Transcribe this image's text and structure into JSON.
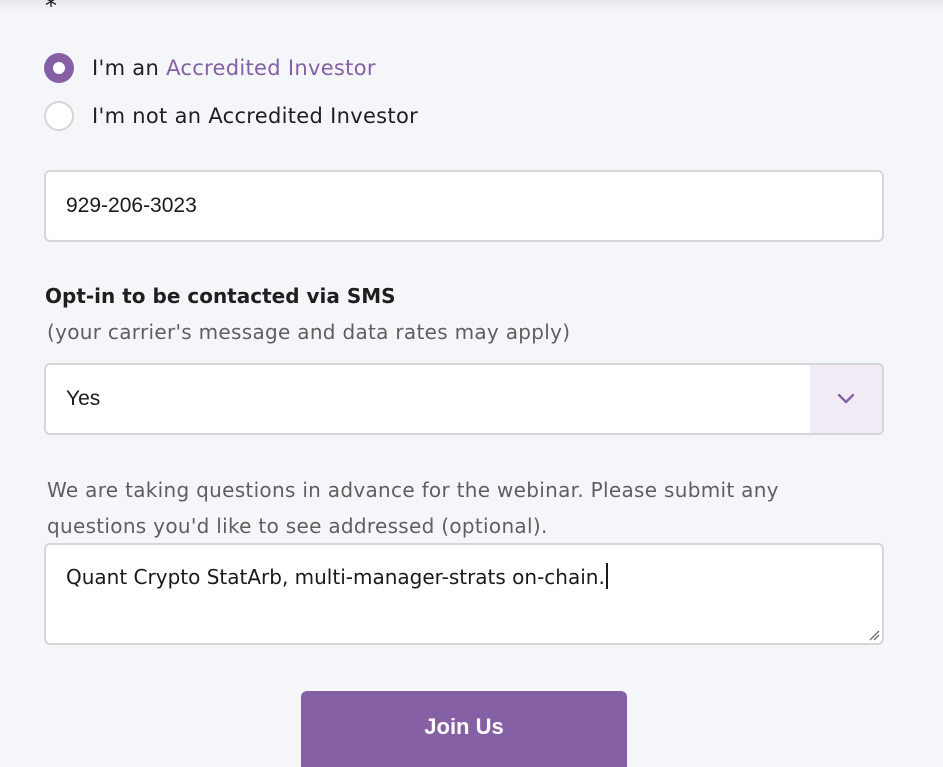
{
  "form": {
    "required_marker": "*",
    "investor_options": [
      {
        "prefix": "I'm an ",
        "link_text": "Accredited Investor",
        "checked": true
      },
      {
        "prefix": "I'm not an Accredited Investor",
        "link_text": "",
        "checked": false
      }
    ],
    "phone": {
      "value": "929-206-3023",
      "placeholder": ""
    },
    "sms_optin": {
      "title": "Opt-in to be contacted via SMS",
      "hint": "(your carrier's message and data rates may apply)",
      "selected": "Yes",
      "arrow_icon": "chevron-down-icon"
    },
    "questions": {
      "prompt": "We are taking questions in advance for the webinar. Please submit any questions you'd like to see addressed (optional).",
      "value": "Quant Crypto StatArb, multi-manager-strats on-chain."
    },
    "submit_label": "Join Us"
  },
  "colors": {
    "accent": "#8660a4",
    "accent_light": "#f1ebf6",
    "background": "#f4f6fa",
    "border": "#d6d6d6"
  }
}
